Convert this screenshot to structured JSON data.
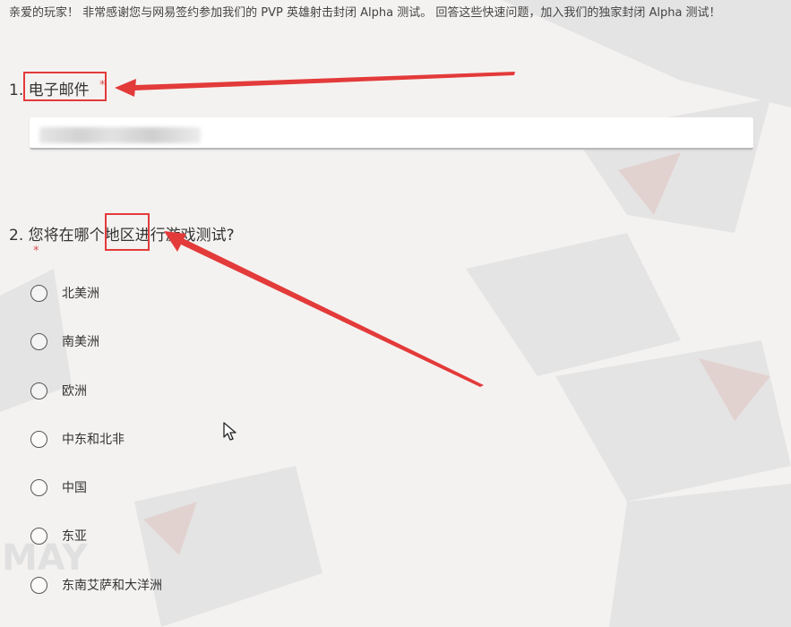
{
  "intro": {
    "text": "亲爱的玩家！ 非常感谢您与网易签约参加我们的 PVP 英雄射击封闭 Alpha 测试。 回答这些快速问题，加入我们的独家封闭 Alpha 测试！"
  },
  "questions": [
    {
      "number": "1.",
      "label": "电子邮件",
      "required_mark": "*",
      "input_value": ""
    },
    {
      "number": "2.",
      "label_prefix": "您将在哪个",
      "label_highlight": "地区",
      "label_suffix": "进行游戏测试?",
      "required_mark": "*",
      "options": [
        "北美洲",
        "南美洲",
        "欧洲",
        "中东和北非",
        "中国",
        "东亚",
        "东南艾萨和大洋洲"
      ]
    }
  ],
  "background_watermark": "MAY",
  "colors": {
    "highlight": "#e33a3a",
    "required": "#d9534f",
    "page_background": "#f4f2f0"
  }
}
